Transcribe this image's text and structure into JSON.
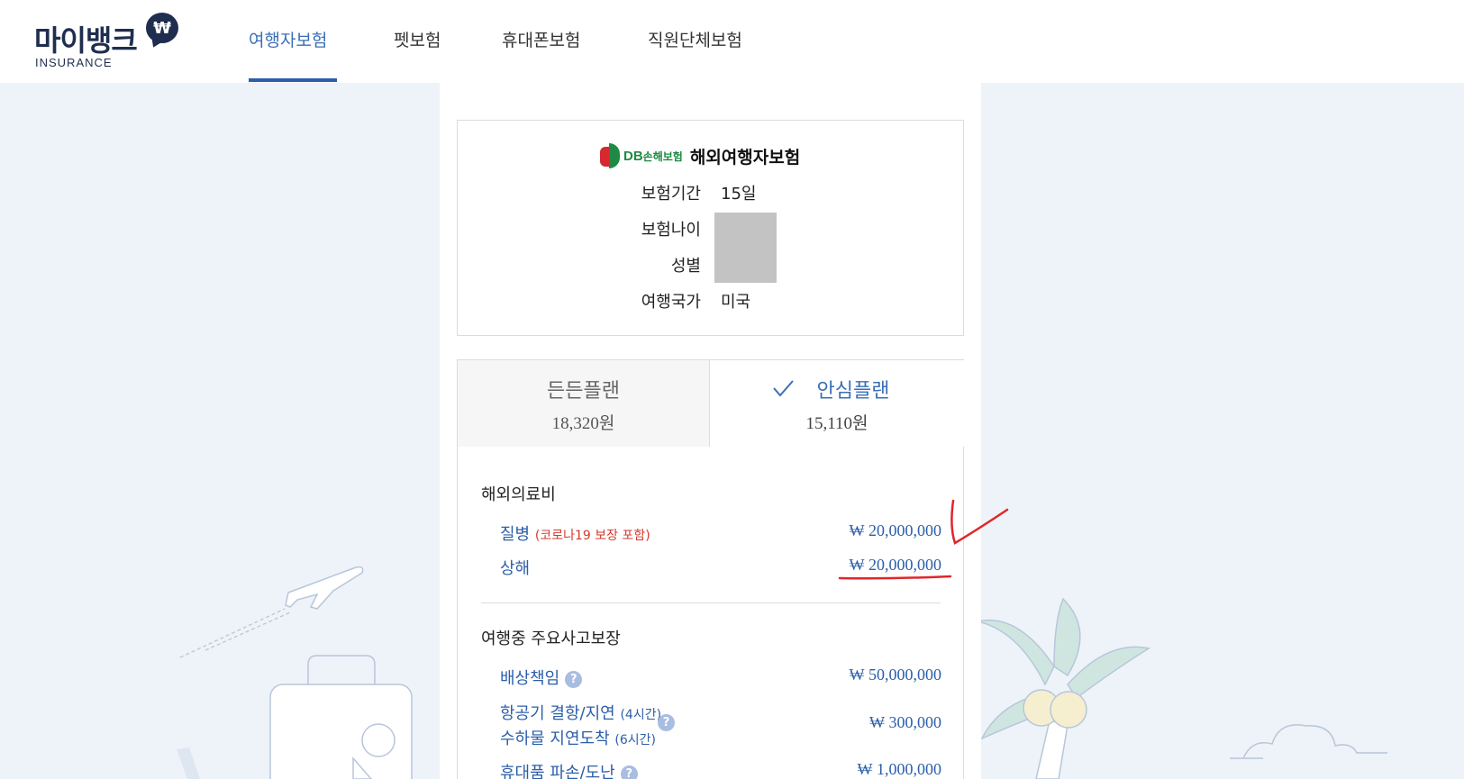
{
  "header": {
    "logo_main": "마이뱅크",
    "logo_badge": "₩",
    "logo_sub": "INSURANCE",
    "nav": [
      {
        "label": "여행자보험",
        "active": true
      },
      {
        "label": "펫보험",
        "active": false
      },
      {
        "label": "휴대폰보험",
        "active": false
      },
      {
        "label": "직원단체보험",
        "active": false
      }
    ]
  },
  "info": {
    "insurer_logo_main": "DB",
    "insurer_logo_sub": "손해보험",
    "product_name": "해외여행자보험",
    "rows": [
      {
        "label": "보험기간",
        "value": "15일"
      },
      {
        "label": "보험나이",
        "value": ""
      },
      {
        "label": "성별",
        "value": ""
      },
      {
        "label": "여행국가",
        "value": "미국"
      }
    ]
  },
  "plans": [
    {
      "name": "든든플랜",
      "price": "18,320원",
      "selected": false
    },
    {
      "name": "안심플랜",
      "price": "15,110원",
      "selected": true
    }
  ],
  "coverage": {
    "medical": {
      "title": "해외의료비",
      "items": [
        {
          "label": "질병",
          "note": "(코로나19 보장 포함)",
          "amount": "₩ 20,000,000"
        },
        {
          "label": "상해",
          "note": "",
          "amount": "₩ 20,000,000"
        }
      ]
    },
    "accident": {
      "title": "여행중 주요사고보장",
      "items": [
        {
          "label": "배상책임",
          "amount": "₩ 50,000,000"
        },
        {
          "label": "항공기 결항/지연",
          "note": "(4시간)",
          "label2": "수하물 지연도착",
          "note2": "(6시간)",
          "amount": "₩ 300,000"
        },
        {
          "label": "휴대품 파손/도난",
          "amount": "₩ 1,000,000"
        }
      ]
    }
  },
  "icons": {
    "help": "?"
  },
  "colors": {
    "accent": "#2c5fa8",
    "annotation": "#e0262a",
    "brand": "#1f2d4f"
  }
}
